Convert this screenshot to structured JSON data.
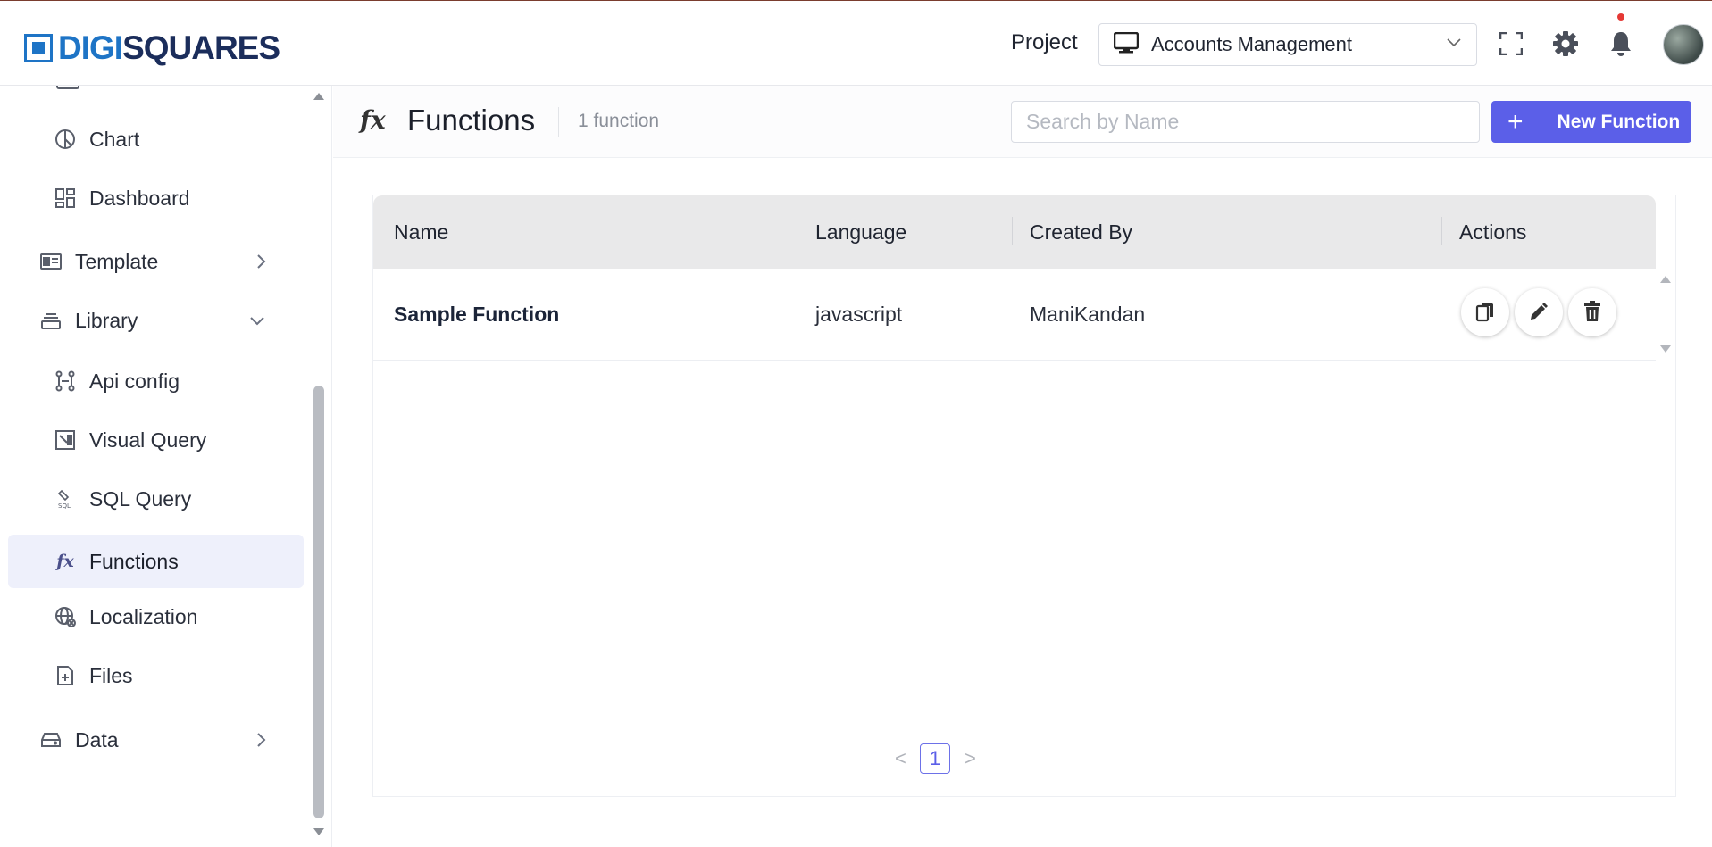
{
  "brand": {
    "logo_prefix": "DIGI",
    "logo_suffix": "SQUARES"
  },
  "header": {
    "project_label": "Project",
    "project_value": "Accounts Management"
  },
  "sidebar": {
    "items": [
      {
        "label": "Chart",
        "icon": "chart-icon"
      },
      {
        "label": "Dashboard",
        "icon": "dashboard-icon"
      },
      {
        "label": "Template",
        "icon": "template-icon"
      },
      {
        "label": "Library",
        "icon": "library-icon"
      },
      {
        "label": "Api config",
        "icon": "api-config-icon"
      },
      {
        "label": "Visual Query",
        "icon": "visual-query-icon"
      },
      {
        "label": "SQL Query",
        "icon": "sql-query-icon"
      },
      {
        "label": "Functions",
        "icon": "fx-icon",
        "active": true
      },
      {
        "label": "Localization",
        "icon": "localization-icon"
      },
      {
        "label": "Files",
        "icon": "files-icon"
      },
      {
        "label": "Data",
        "icon": "data-icon"
      }
    ]
  },
  "page": {
    "icon_text": "fx",
    "title": "Functions",
    "count": "1 function",
    "search_placeholder": "Search by Name",
    "new_button_icon": "+",
    "new_button_label": "New Function"
  },
  "table": {
    "columns": [
      "Name",
      "Language",
      "Created By",
      "Actions"
    ],
    "rows": [
      {
        "name": "Sample Function",
        "language": "javascript",
        "created_by": "ManiKandan"
      }
    ],
    "actions": [
      "copy-icon",
      "edit-icon",
      "delete-icon"
    ]
  },
  "pagination": {
    "current_page": "1",
    "prev": "<",
    "next": ">"
  },
  "colors": {
    "accent": "#5b5fe8",
    "brand_blue": "#1e74c6",
    "active_bg": "#eef0fb",
    "notification": "#e53935"
  }
}
